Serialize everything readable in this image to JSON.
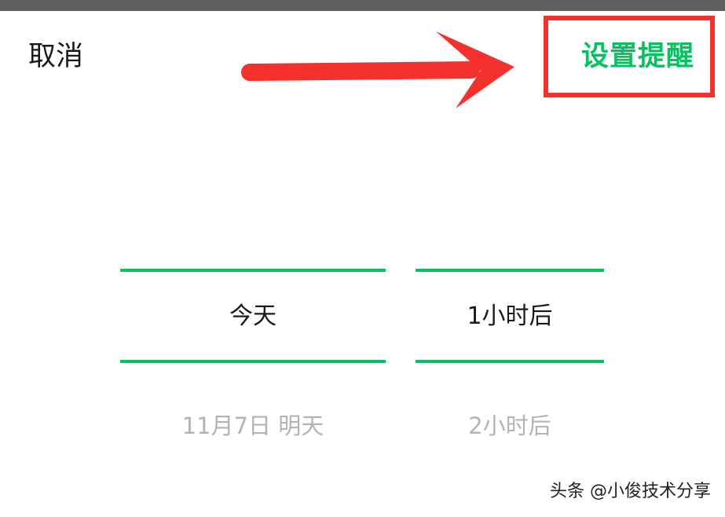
{
  "header": {
    "cancel_label": "取消",
    "confirm_label": "设置提醒"
  },
  "picker": {
    "date_column": {
      "selected": "今天",
      "next": "11月7日 明天"
    },
    "time_column": {
      "selected": "1小时后",
      "next": "2小时后"
    }
  },
  "watermark": {
    "text": "头条 @小俊技术分享"
  },
  "colors": {
    "accent": "#07c160",
    "annotation_red": "#f4312d",
    "status_strip": "#5f5f5f",
    "primary_text": "#1a1a1a",
    "muted_text": "#b3b3b3"
  }
}
